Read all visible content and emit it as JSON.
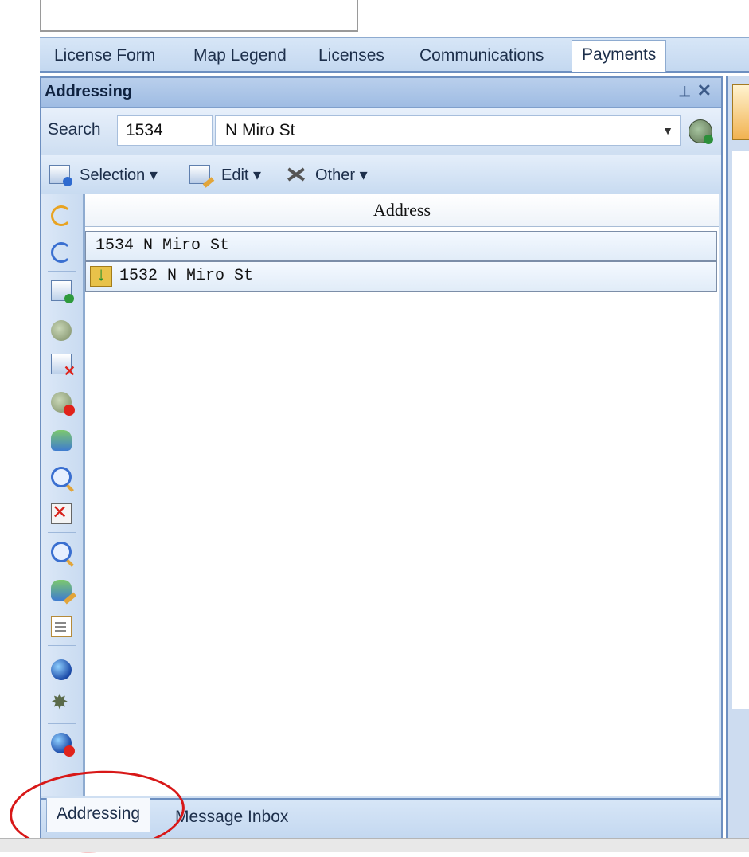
{
  "tabs": [
    {
      "label": "License Form"
    },
    {
      "label": "Map Legend"
    },
    {
      "label": "Licenses"
    },
    {
      "label": "Communications"
    },
    {
      "label": "Payments",
      "active": true
    }
  ],
  "panel": {
    "title": "Addressing",
    "pin_icon": "pin-icon",
    "close_icon": "close-icon"
  },
  "search": {
    "label": "Search",
    "number": "1534",
    "street": "N Miro St",
    "go_icon": "map-search-icon"
  },
  "toolbar": {
    "selection_label": "Selection",
    "edit_label": "Edit",
    "other_label": "Other",
    "dropdown_glyph": "▾"
  },
  "list": {
    "header": "Address",
    "rows": [
      {
        "text": "1534 N Miro St",
        "icon": null
      },
      {
        "text": "1532 N Miro St",
        "icon": "folder-download-icon"
      }
    ]
  },
  "bottom_tabs": [
    {
      "label": "Addressing",
      "active": true
    },
    {
      "label": "Message Inbox"
    }
  ],
  "colors": {
    "accent": "#6d8fc0",
    "annotation_circle": "#d81818"
  }
}
